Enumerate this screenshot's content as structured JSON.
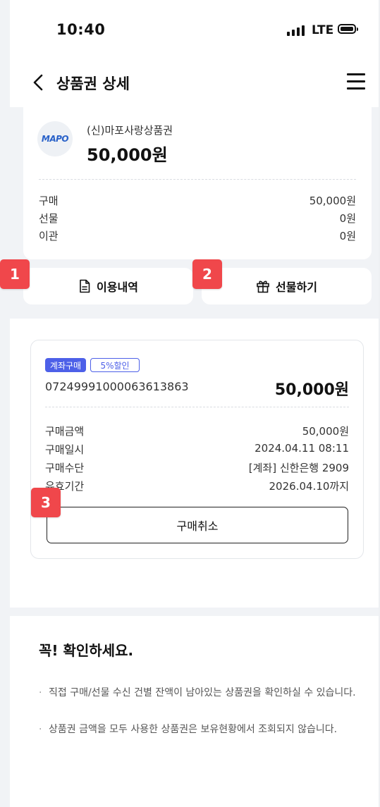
{
  "status_bar": {
    "time": "10:40",
    "network": "LTE"
  },
  "header": {
    "title": "상품권 상세"
  },
  "gift_card": {
    "logo_text": "MAPO",
    "name": "(신)마포사랑상품권",
    "amount": "50,000원",
    "rows": [
      {
        "label": "구매",
        "value": "50,000원"
      },
      {
        "label": "선물",
        "value": "0원"
      },
      {
        "label": "이관",
        "value": "0원"
      }
    ]
  },
  "actions": {
    "history_label": "이용내역",
    "gift_label": "선물하기"
  },
  "markers": {
    "m1": "1",
    "m2": "2",
    "m3": "3"
  },
  "purchase": {
    "tag_type": "계좌구매",
    "tag_discount": "5%할인",
    "order_number": "07249991000063613863",
    "amount": "50,000원",
    "rows": [
      {
        "label": "구매금액",
        "value": "50,000원"
      },
      {
        "label": "구매일시",
        "value": "2024.04.11 08:11"
      },
      {
        "label": "구매수단",
        "value": "[계좌] 신한은행 2909"
      },
      {
        "label": "유효기간",
        "value": "2026.04.10까지"
      }
    ],
    "cancel_label": "구매취소"
  },
  "notice": {
    "title": "꼭! 확인하세요.",
    "items": [
      "직접 구매/선물 수신 건별 잔액이 남아있는 상품권을 확인하실 수 있습니다.",
      "상품권 금액을 모두 사용한 상품권은 보유현황에서 조회되지 않습니다."
    ]
  },
  "colors": {
    "accent": "#4d60e8",
    "marker": "#f0474b",
    "background": "#f1f3f6"
  }
}
